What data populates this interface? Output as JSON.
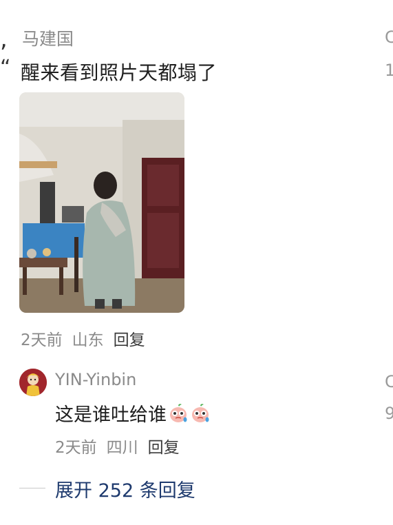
{
  "comment": {
    "username": "马建国",
    "text": "醒来看到照片天都塌了",
    "time": "2天前",
    "location": "山东",
    "reply_label": "回复",
    "right_edge_top": "C",
    "right_edge_count": "1"
  },
  "sub_comment": {
    "username": "YIN-Yinbin",
    "text": "这是谁吐给谁",
    "emojis": [
      "crying-peach-emoji",
      "crying-peach-emoji"
    ],
    "time": "2天前",
    "location": "四川",
    "reply_label": "回复",
    "right_edge_top": "C",
    "right_edge_count": "9"
  },
  "expand": {
    "label": "展开 252 条回复"
  },
  "edge_marks": {
    "comma": ",",
    "quote": "“"
  }
}
